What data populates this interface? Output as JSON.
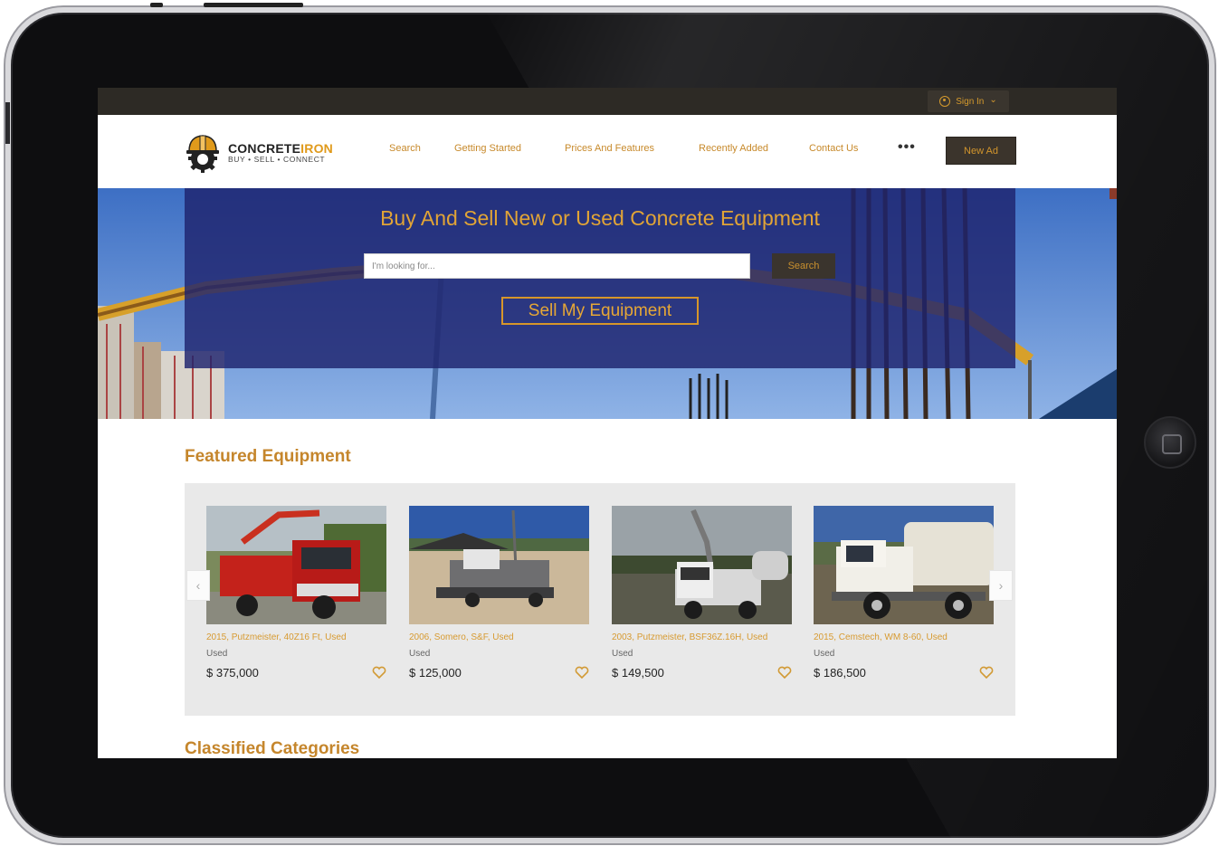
{
  "topbar": {
    "signin_label": "Sign In",
    "signin_chevron": "⌄",
    "user_icon": "user-circle-icon"
  },
  "brand": {
    "name_dark": "CONCRETE",
    "name_accent": "IRON",
    "tagline": "BUY • SELL • CONNECT",
    "accent": "#e09a1b"
  },
  "nav": {
    "items": [
      {
        "label": "Search"
      },
      {
        "label": "Getting Started"
      },
      {
        "label": "Prices And Features"
      },
      {
        "label": "Recently Added"
      },
      {
        "label": "Contact Us"
      }
    ],
    "more_label": "•••",
    "new_ad_label": "New Ad"
  },
  "hero": {
    "title": "Buy And Sell New or Used Concrete Equipment",
    "search_placeholder": "I'm looking for...",
    "search_button": "Search",
    "sell_button": "Sell My Equipment"
  },
  "featured": {
    "title": "Featured Equipment",
    "prev_label": "‹",
    "next_label": "›",
    "items": [
      {
        "caption": "2015, Putzmeister, 40Z16 Ft, Used",
        "condition": "Used",
        "price": "$ 375,000",
        "photo": "red-pump-truck"
      },
      {
        "caption": "2006, Somero, S&F, Used",
        "condition": "Used",
        "price": "$ 125,000",
        "photo": "screed-machine"
      },
      {
        "caption": "2003, Putzmeister, BSF36Z.16H, Used",
        "condition": "Used",
        "price": "$ 149,500",
        "photo": "boom-pump-truck"
      },
      {
        "caption": "2015, Cemstech, WM 8-60, Used",
        "condition": "Used",
        "price": "$ 186,500",
        "photo": "white-mixer-truck"
      }
    ]
  },
  "classified": {
    "title": "Classified Categories"
  }
}
